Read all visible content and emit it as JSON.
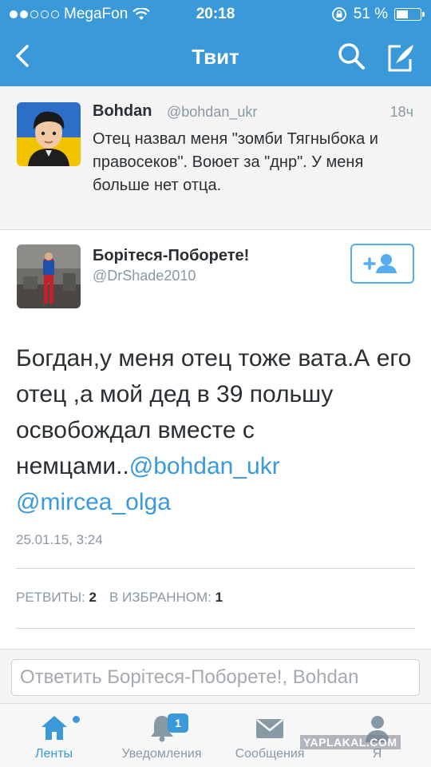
{
  "status_bar": {
    "carrier": "MegaFon",
    "time": "20:18",
    "battery": "51 %",
    "battery_level": 0.51
  },
  "nav": {
    "title": "Твит"
  },
  "parent_tweet": {
    "name": "Bohdan",
    "handle": "@bohdan_ukr",
    "time": "18ч",
    "text": "Отец назвал меня \"зомби Тягныбока и правосеков\". Воюет за \"днр\". У меня больше нет отца."
  },
  "main_tweet": {
    "name": "Борітеся-Поборете!",
    "handle": "@DrShade2010",
    "text": "Богдан,у меня отец тоже вата.А его отец ,а мой дед в 39 польшу освобождал вместе с немцами..",
    "mention_1": "@bohdan_ukr",
    "mention_2": "@mircea_olga",
    "date": "25.01.15, 3:24",
    "retweets_label": "РЕТВИТЫ:",
    "retweets_count": "2",
    "favorites_label": "В ИЗБРАННОМ:",
    "favorites_count": "1"
  },
  "reply": {
    "placeholder": "Ответить Борітеся-Поборете!, Bohdan"
  },
  "tabs": [
    {
      "label": "Ленты",
      "icon": "home-icon"
    },
    {
      "label": "Уведомления",
      "icon": "bell-icon",
      "badge": "1"
    },
    {
      "label": "Сообщения",
      "icon": "envelope-icon"
    },
    {
      "label": "Я",
      "icon": "person-icon"
    }
  ],
  "watermark": "YAPLAKAL.COM",
  "colors": {
    "brand_blue": "#3a99d9",
    "text": "#292f33",
    "muted": "#8899a6"
  }
}
